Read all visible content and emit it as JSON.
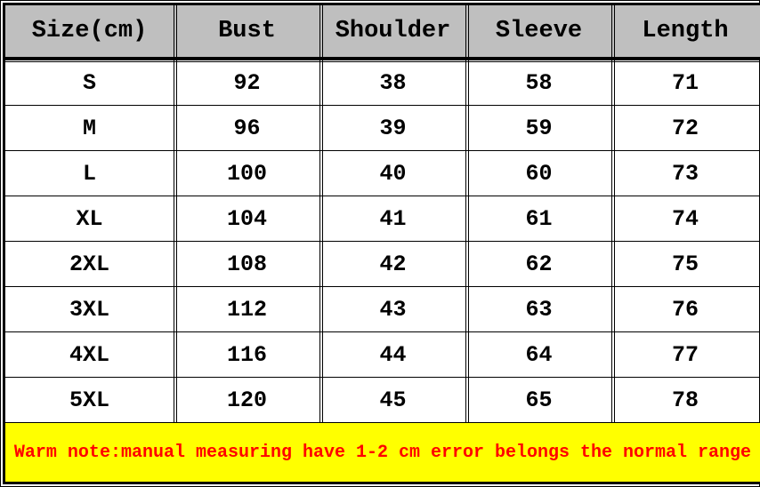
{
  "chart_data": {
    "type": "table",
    "headers": [
      "Size(cm)",
      "Bust",
      "Shoulder",
      "Sleeve",
      "Length"
    ],
    "rows": [
      [
        "S",
        "92",
        "38",
        "58",
        "71"
      ],
      [
        "M",
        "96",
        "39",
        "59",
        "72"
      ],
      [
        "L",
        "100",
        "40",
        "60",
        "73"
      ],
      [
        "XL",
        "104",
        "41",
        "61",
        "74"
      ],
      [
        "2XL",
        "108",
        "42",
        "62",
        "75"
      ],
      [
        "3XL",
        "112",
        "43",
        "63",
        "76"
      ],
      [
        "4XL",
        "116",
        "44",
        "64",
        "77"
      ],
      [
        "5XL",
        "120",
        "45",
        "65",
        "78"
      ]
    ],
    "note": "Warm note:manual measuring have 1-2 cm error belongs the normal range"
  }
}
